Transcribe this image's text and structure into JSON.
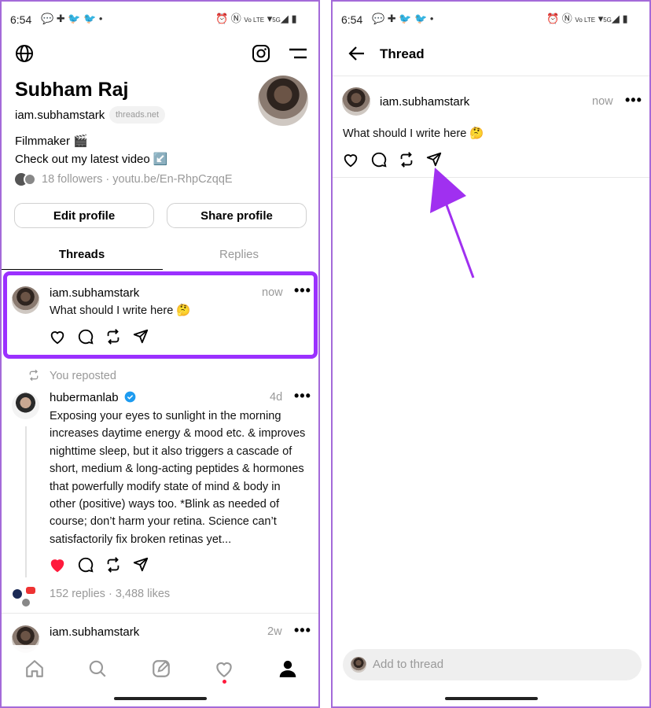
{
  "status_bar": {
    "time": "6:54",
    "network": "5G"
  },
  "profile": {
    "name": "Subham Raj",
    "handle": "iam.subhamstark",
    "domain_badge": "threads.net",
    "bio_line1": "Filmmaker 🎬",
    "bio_line2": "Check out my latest video ↙️",
    "followers": "18 followers",
    "link": "youtu.be/En-RhpCzqqE",
    "edit_button": "Edit profile",
    "share_button": "Share profile"
  },
  "tabs": {
    "threads": "Threads",
    "replies": "Replies"
  },
  "feed": [
    {
      "user": "iam.subhamstark",
      "time": "now",
      "text": "What should I write here 🤔"
    },
    {
      "repost_label": "You reposted",
      "user": "hubermanlab",
      "verified": true,
      "time": "4d",
      "text_lines": [
        "Exposing your eyes to sunlight in the morning",
        "increases daytime energy & mood etc. & improves",
        "nighttime sleep, but it also triggers a cascade of",
        "short, medium & long-acting peptides & hormones",
        "that powerfully modify state of mind & body in",
        "other (positive) ways too. *Blink as needed of",
        "course; don’t harm your retina. Science can’t",
        "satisfactorily fix broken retinas yet..."
      ],
      "stats": "152 replies · 3,488 likes",
      "liked": true
    },
    {
      "user": "iam.subhamstark",
      "time": "2w"
    }
  ],
  "thread_page": {
    "title": "Thread",
    "post": {
      "user": "iam.subhamstark",
      "time": "now",
      "text": "What should I write here 🤔"
    },
    "reply_placeholder": "Add to thread"
  },
  "colors": {
    "highlight": "#9b30ff",
    "arrow": "#a030f0",
    "like_red": "#ff1a3c",
    "verified": "#1d9bf0"
  }
}
